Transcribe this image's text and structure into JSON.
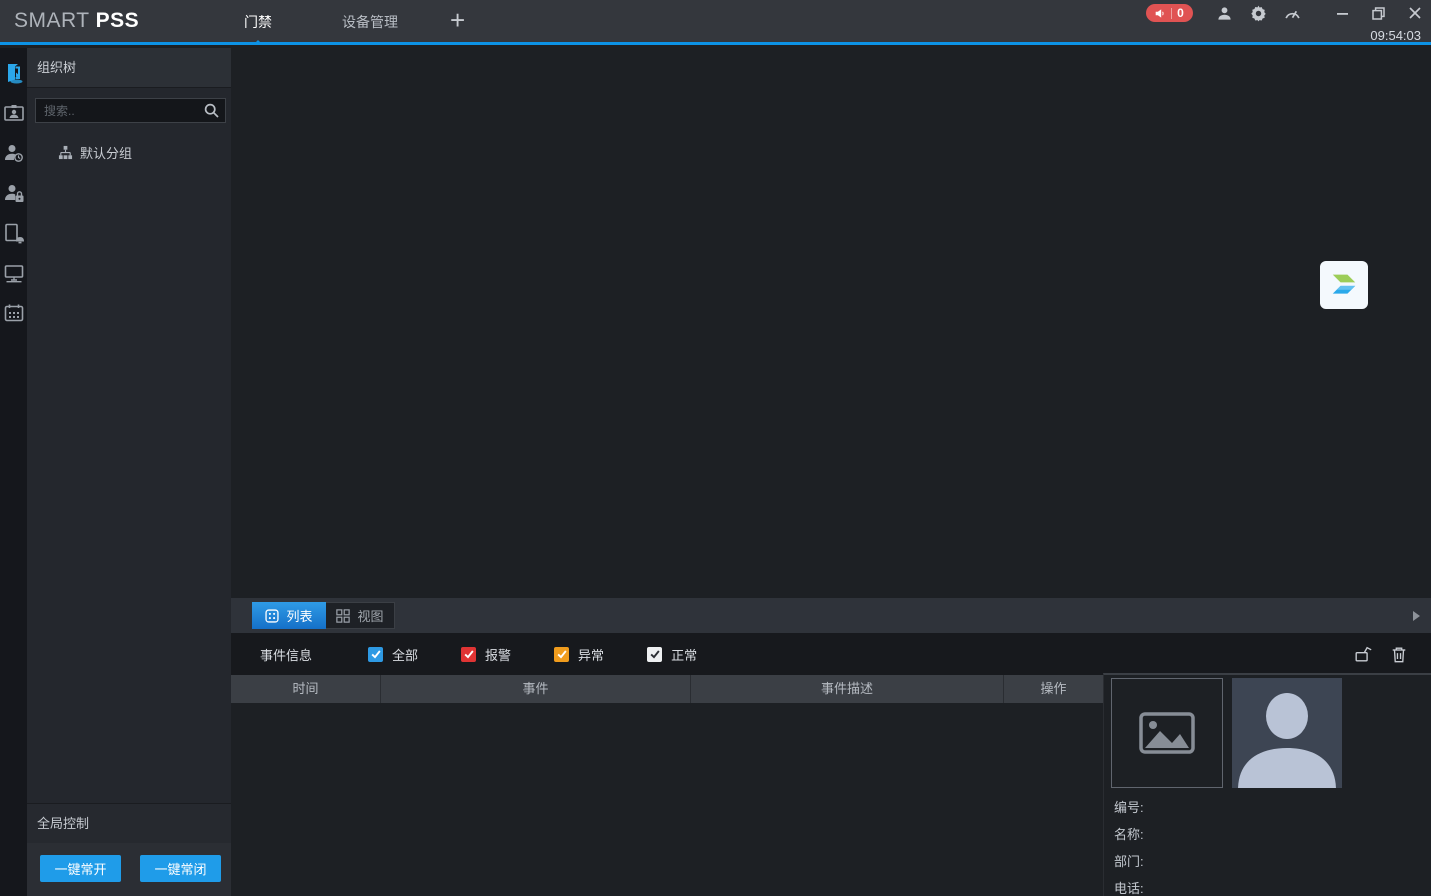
{
  "titlebar": {
    "logo_part1": "SMART",
    "logo_part2": "PSS",
    "tabs": [
      {
        "label": "门禁",
        "active": true
      },
      {
        "label": "设备管理",
        "active": false
      }
    ],
    "add_tab_label": "+",
    "alarm_badge_count": "0",
    "clock": "09:54:03"
  },
  "nav_rail": {
    "items": [
      {
        "icon": "access-control-console-icon",
        "active": true
      },
      {
        "icon": "personnel-card-icon",
        "active": false
      },
      {
        "icon": "user-clock-icon",
        "active": false
      },
      {
        "icon": "user-lock-icon",
        "active": false
      },
      {
        "icon": "device-alarm-icon",
        "active": false
      },
      {
        "icon": "monitor-icon",
        "active": false
      },
      {
        "icon": "calendar-icon",
        "active": false
      }
    ]
  },
  "org_panel": {
    "title": "组织树",
    "search_placeholder": "搜索..",
    "tree_items": [
      {
        "label": "默认分组"
      }
    ],
    "global_control_title": "全局控制",
    "global_buttons": [
      {
        "label": "一键常开"
      },
      {
        "label": "一键常闭"
      }
    ]
  },
  "console": {
    "view_tabs": [
      {
        "label": "列表",
        "active": true
      },
      {
        "label": "视图",
        "active": false
      }
    ],
    "event_bar": {
      "title": "事件信息",
      "filters": [
        {
          "label": "全部",
          "color": "#2e9ae4",
          "check_color": "#ffffff",
          "checked": true
        },
        {
          "label": "报警",
          "color": "#e03434",
          "check_color": "#ffffff",
          "checked": true
        },
        {
          "label": "异常",
          "color": "#f09c1d",
          "check_color": "#ffffff",
          "checked": true
        },
        {
          "label": "正常",
          "color": "#eef0f2",
          "check_color": "#2a2d33",
          "checked": true
        }
      ]
    },
    "table": {
      "columns": [
        {
          "label": "时间"
        },
        {
          "label": "事件"
        },
        {
          "label": "事件描述"
        },
        {
          "label": "操作"
        }
      ],
      "rows": []
    },
    "detail": {
      "fields": [
        {
          "label": "编号:"
        },
        {
          "label": "名称:"
        },
        {
          "label": "部门:"
        },
        {
          "label": "电话:"
        }
      ]
    }
  },
  "colors": {
    "accent_blue": "#1f9ce9",
    "header_line_blue": "#0d93e6",
    "alarm_badge_red": "#e05353",
    "logo_green": "#9ccd58",
    "logo_blue": "#2aa9ea"
  }
}
